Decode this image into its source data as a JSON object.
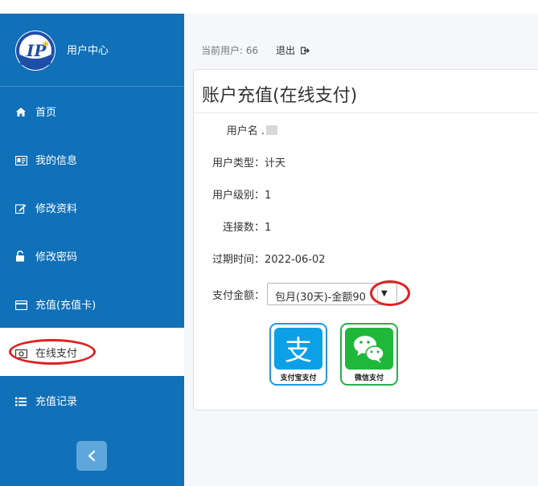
{
  "brand": {
    "title": "用户中心"
  },
  "nav": [
    {
      "label": "首页",
      "icon": "home-icon",
      "active": false
    },
    {
      "label": "我的信息",
      "icon": "id-card-icon",
      "active": false
    },
    {
      "label": "修改资料",
      "icon": "edit-icon",
      "active": false
    },
    {
      "label": "修改密码",
      "icon": "lock-icon",
      "active": false
    },
    {
      "label": "充值(充值卡)",
      "icon": "credit-card-icon",
      "active": false
    },
    {
      "label": "在线支付",
      "icon": "money-icon",
      "active": true
    },
    {
      "label": "充值记录",
      "icon": "list-icon",
      "active": false
    }
  ],
  "topbar": {
    "current_user_label": "当前用户: 66",
    "logout_label": "退出"
  },
  "panel": {
    "title": "账户充值(在线支付)",
    "username_label": "用户名 .",
    "user_type_label": "用户类型：",
    "user_type_value": "计天",
    "user_level_label": "用户级别：",
    "user_level_value": "1",
    "connections_label": "连接数：",
    "connections_value": "1",
    "expiry_label": "过期时间：",
    "expiry_value": "2022-06-02",
    "amount_label": "支付金额：",
    "amount_selected": "包月(30天)-金额90"
  },
  "payment": {
    "alipay_caption": "支付宝支付",
    "alipay_glyph": "支",
    "wechat_caption": "微信支付"
  },
  "colors": {
    "sidebar": "#1070b8",
    "annotation": "#e02020",
    "alipay": "#0ba0e8",
    "wechat": "#1fb83a"
  }
}
